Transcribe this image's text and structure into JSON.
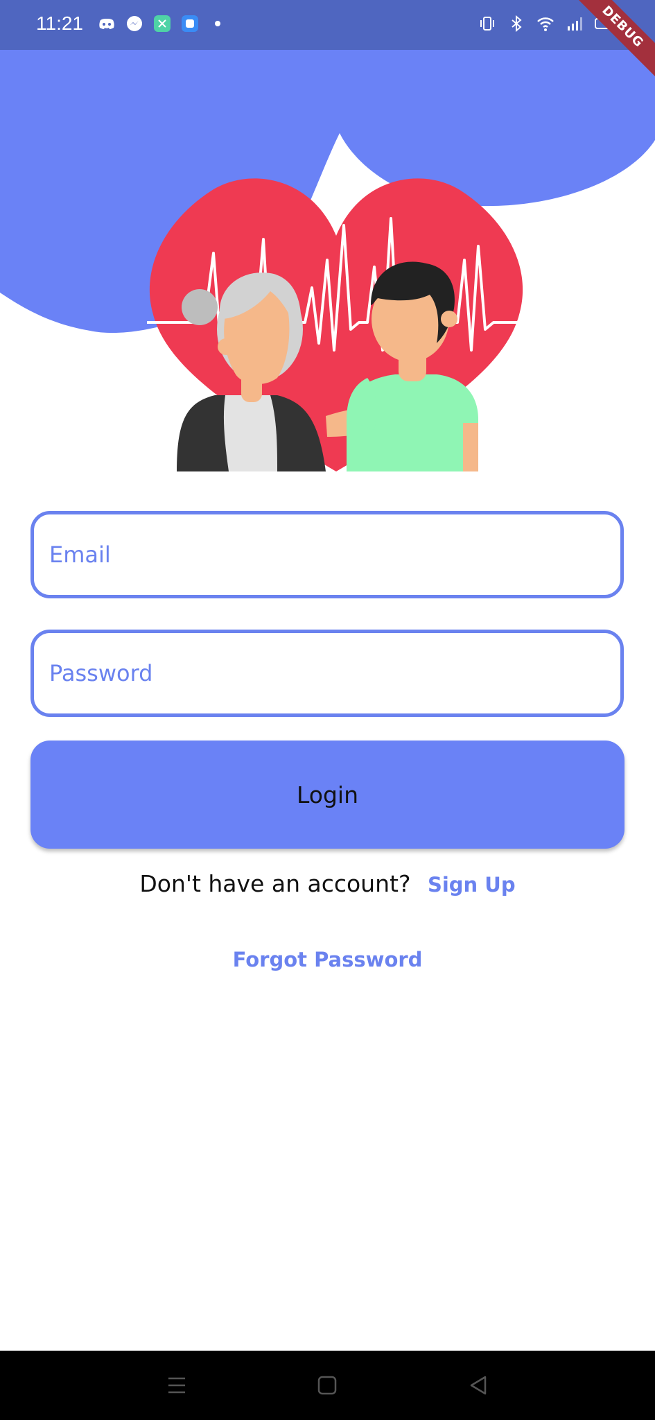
{
  "status_bar": {
    "time": "11:21",
    "left_icons": [
      "discord-icon",
      "messenger-icon",
      "app-icon",
      "app-icon-blue",
      "dot-icon"
    ],
    "right_icons": [
      "vibrate-icon",
      "bluetooth-icon",
      "wifi-icon",
      "signal-icon",
      "battery-icon"
    ]
  },
  "debug_banner": "DEBUG",
  "illustration": {
    "description_icon": "elderly-care-heart-illustration"
  },
  "form": {
    "email_placeholder": "Email",
    "password_placeholder": "Password",
    "login_label": "Login"
  },
  "signup": {
    "prompt": "Don't have an account?",
    "link": "Sign Up"
  },
  "forgot_password": "Forgot Password",
  "nav_bar": {
    "icons": [
      "menu-icon",
      "home-icon",
      "back-icon"
    ]
  },
  "colors": {
    "accent": "#6a82ef",
    "status_bar": "#4f66c0",
    "heart": "#ef3a52",
    "shirt": "#8ff5b4"
  }
}
